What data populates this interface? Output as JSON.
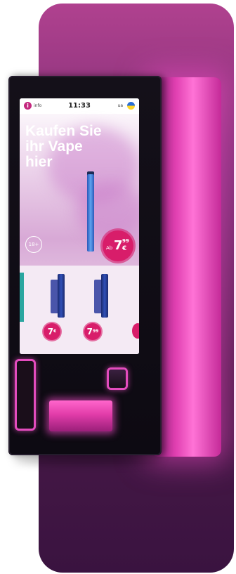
{
  "screen": {
    "status": {
      "info_label": "info",
      "time": "11:33",
      "lang_label": "ua"
    },
    "hero": {
      "title": "Kaufen Sie\nihr Vape\nhier",
      "age_badge": "18+"
    },
    "price": {
      "prefix": "Ab",
      "main": "7",
      "cents": "99",
      "currency": "€"
    },
    "products": [
      {
        "price": "7",
        "currency": "€"
      },
      {
        "price": "7",
        "cents": "99",
        "currency": "€"
      }
    ]
  },
  "colors": {
    "accent": "#d81d6a",
    "glow": "#e44cbe",
    "panel": "#7a2e73"
  },
  "icons": [
    "info-icon",
    "flag-icon"
  ]
}
